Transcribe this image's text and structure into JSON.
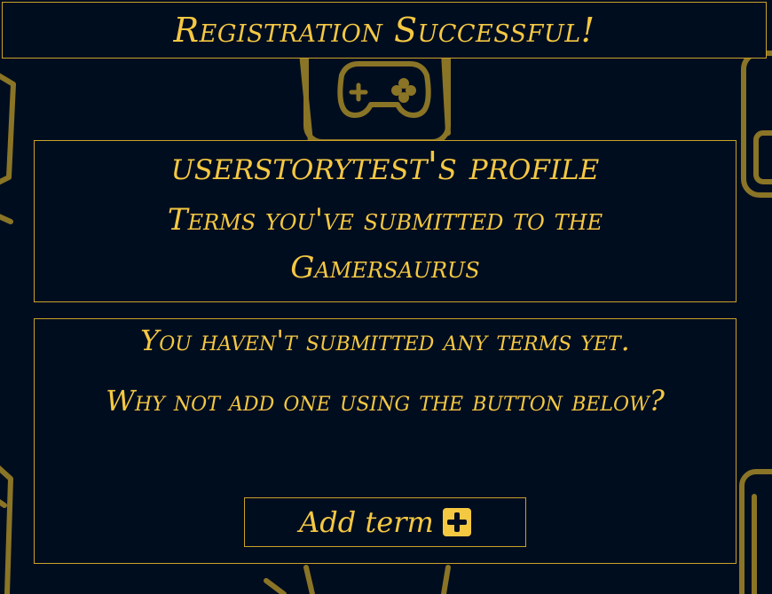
{
  "flash": {
    "message": "Registration Successful!"
  },
  "profile": {
    "title": "userstorytest's profile",
    "subtitle": "Terms you've submitted to the Gamersaurus"
  },
  "terms": {
    "empty_message": "You haven't submitted any terms yet.",
    "prompt": "Why not add one using the button below?",
    "add_button_label": "Add term",
    "add_button_icon": "plus-square-icon"
  },
  "colors": {
    "background": "#000d1f",
    "accent": "#f5c842",
    "border": "#c9a227",
    "pattern": "#8a7426"
  }
}
